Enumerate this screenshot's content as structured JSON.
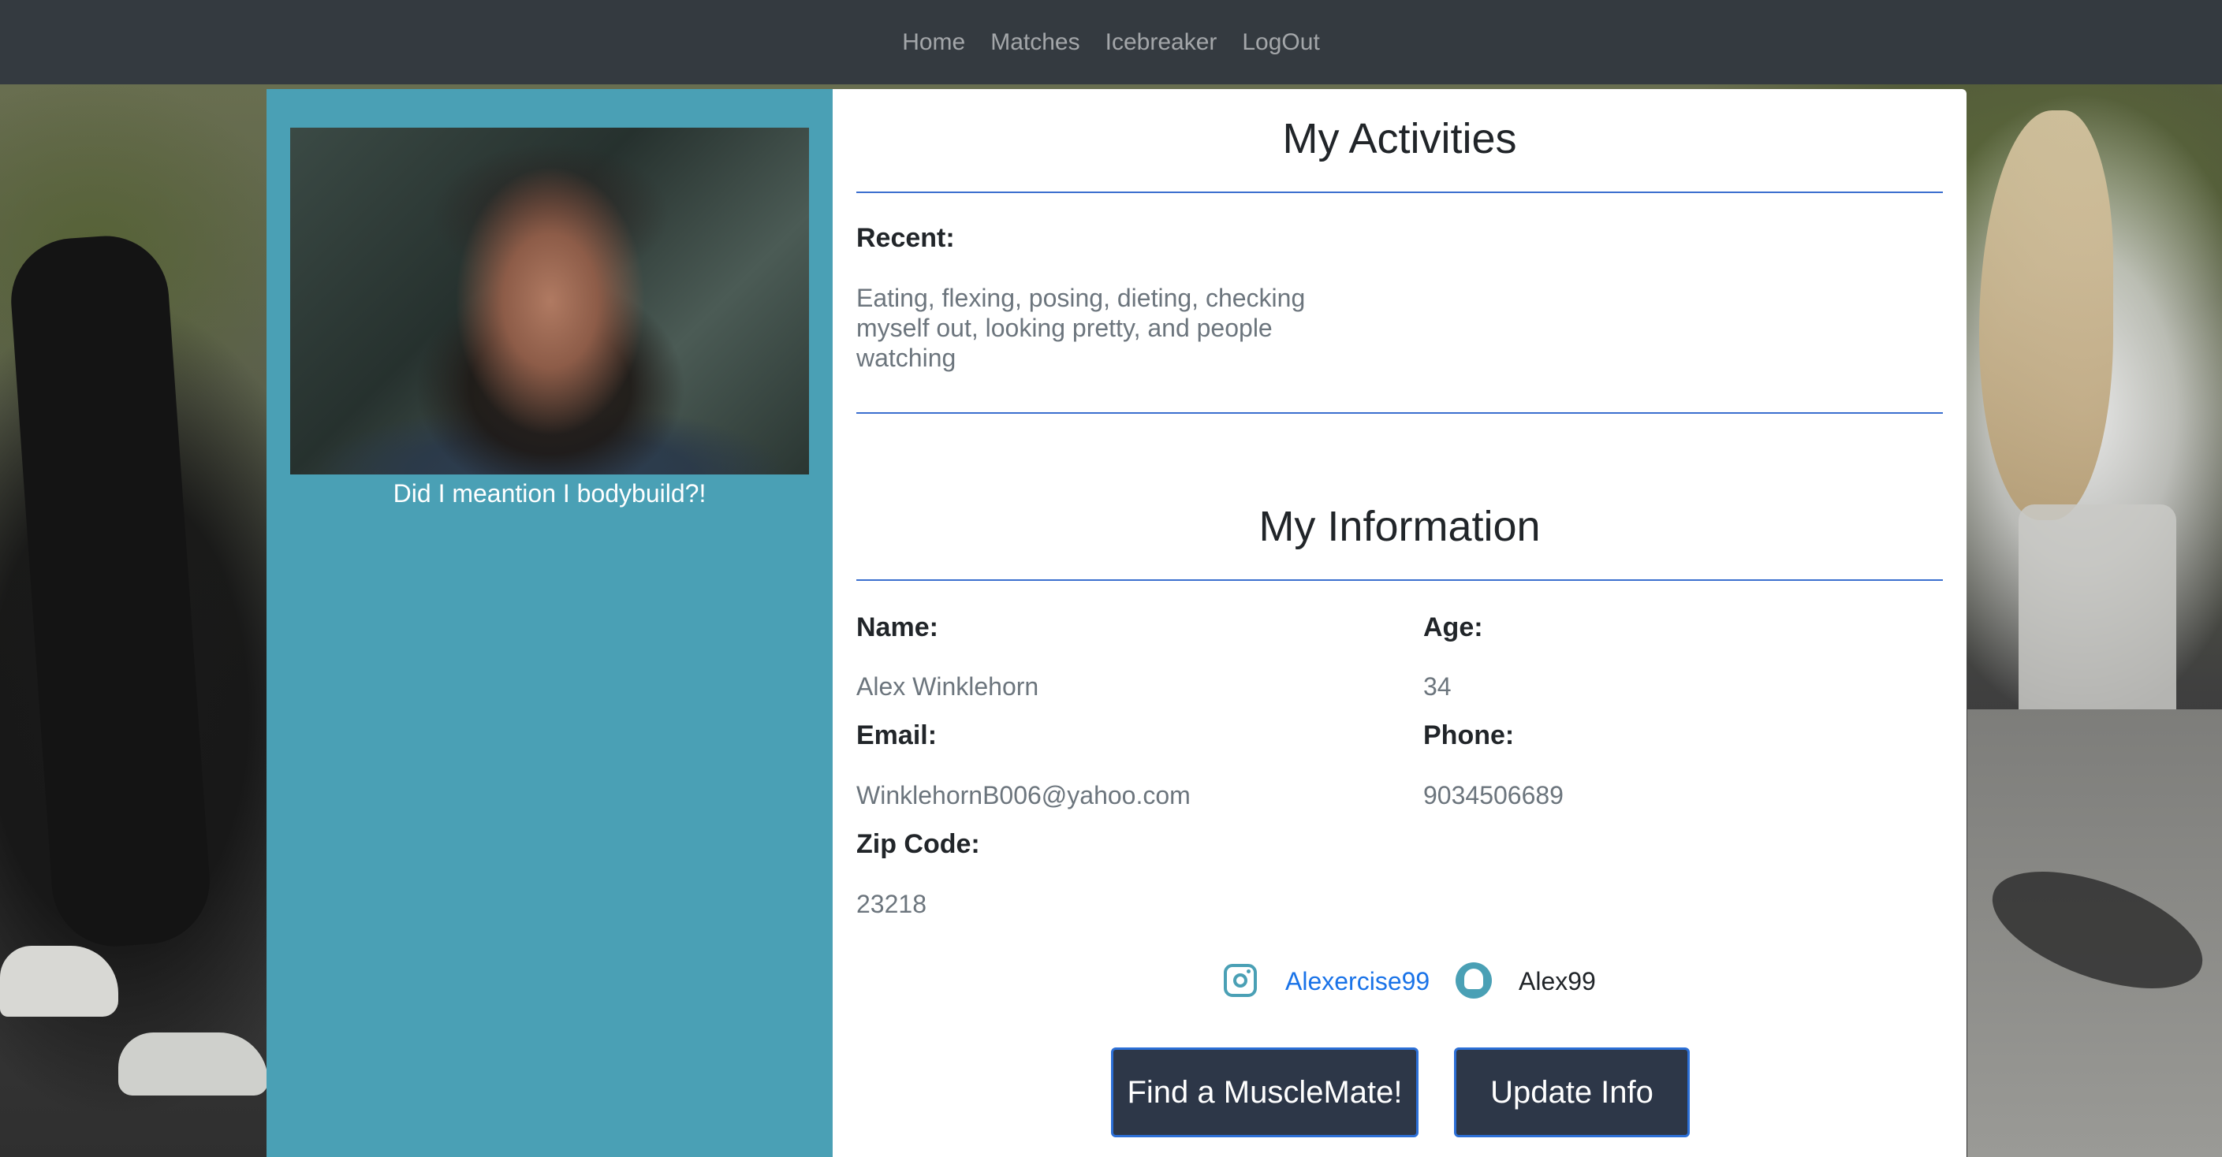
{
  "nav": {
    "items": [
      "Home",
      "Matches",
      "Icebreaker",
      "LogOut"
    ]
  },
  "profile": {
    "photo_alt": "profile photo",
    "caption": "Did I meantion I bodybuild?!"
  },
  "activities": {
    "title": "My Activities",
    "recent_label": "Recent:",
    "recent_text": "Eating, flexing, posing, dieting, checking myself out, looking pretty, and people watching"
  },
  "info": {
    "title": "My Information",
    "name_label": "Name:",
    "name_value": "Alex Winklehorn",
    "age_label": "Age:",
    "age_value": "34",
    "email_label": "Email:",
    "email_value": "WinklehornB006@yahoo.com",
    "phone_label": "Phone:",
    "phone_value": "9034506689",
    "zip_label": "Zip Code:",
    "zip_value": "23218"
  },
  "social": {
    "instagram_icon": "instagram-icon",
    "instagram_handle": "Alexercise99",
    "snapchat_icon": "snapchat-icon",
    "snapchat_handle": "Alex99"
  },
  "buttons": {
    "find_label": "Find a MuscleMate!",
    "update_label": "Update Info"
  },
  "colors": {
    "navbar": "#343a40",
    "left_panel": "#4aa0b5",
    "accent_line": "#3b6fcf",
    "button_bg": "#2d3748",
    "link": "#1a73e8"
  }
}
